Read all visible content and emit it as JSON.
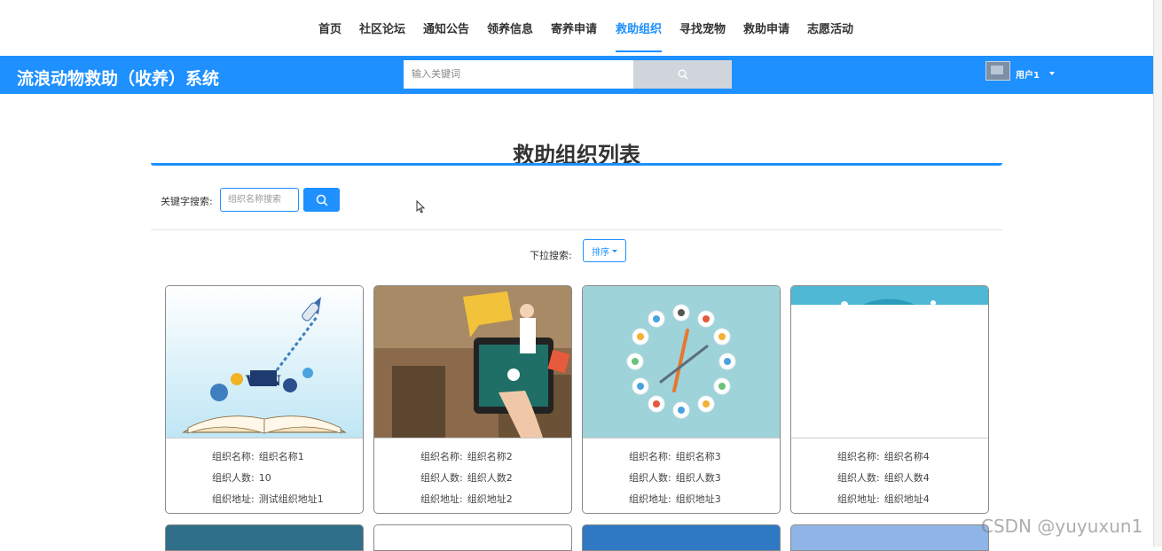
{
  "topnav": {
    "items": [
      "首页",
      "社区论坛",
      "通知公告",
      "领养信息",
      "寄养申请",
      "救助组织",
      "寻找宠物",
      "救助申请",
      "志愿活动"
    ],
    "active": "救助组织"
  },
  "header": {
    "title": "流浪动物救助（收养）系统",
    "search_placeholder": "输入关键词",
    "username": "用户1"
  },
  "page": {
    "title": "救助组织列表",
    "keyword_label": "关键字搜索:",
    "keyword_placeholder": "组织名称搜索",
    "dropdown_label": "下拉搜索:",
    "dropdown_button": "排序"
  },
  "field_labels": {
    "name": "组织名称:",
    "count": "组织人数:",
    "address": "组织地址:"
  },
  "cards": [
    {
      "name": "组织名称1",
      "count": "10",
      "address": "测试组织地址1",
      "image": "open-book-win-illustration"
    },
    {
      "name": "组织名称2",
      "count": "组织人数2",
      "address": "组织地址2",
      "image": "teacher-tablet-photo"
    },
    {
      "name": "组织名称3",
      "count": "组织人数3",
      "address": "组织地址3",
      "image": "education-icons-clock"
    },
    {
      "name": "组织名称4",
      "count": "组织人数4",
      "address": "组织地址4",
      "image": "partially-loaded-banner"
    }
  ],
  "colors": {
    "primary": "#1e90ff",
    "text": "#333333"
  },
  "watermark": "CSDN @yuyuxun1"
}
